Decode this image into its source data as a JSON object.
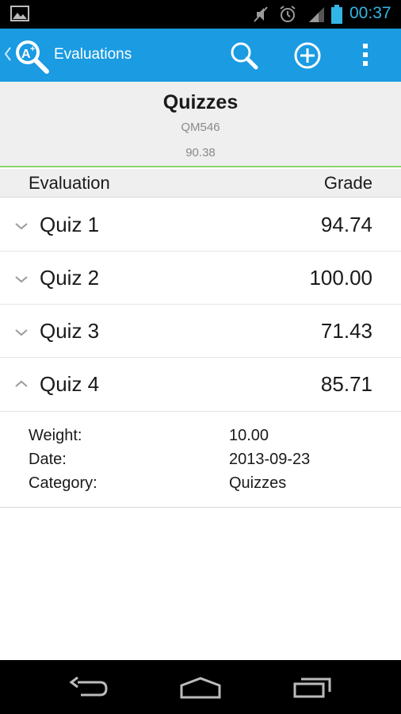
{
  "status_bar": {
    "time": "00:37",
    "icons": [
      "gallery-icon",
      "mute-icon",
      "alarm-icon",
      "signal-icon",
      "battery-icon"
    ],
    "accent": "#33b5e5"
  },
  "action_bar": {
    "title": "Evaluations",
    "color": "#1a9be2",
    "actions": [
      "search-icon",
      "add-icon",
      "overflow-menu-icon"
    ]
  },
  "course": {
    "name": "Quizzes",
    "code": "QM546",
    "average": "90.38"
  },
  "columns": {
    "evaluation": "Evaluation",
    "grade": "Grade"
  },
  "evaluations": [
    {
      "name": "Quiz 1",
      "grade": "94.74",
      "expanded": false
    },
    {
      "name": "Quiz 2",
      "grade": "100.00",
      "expanded": false
    },
    {
      "name": "Quiz 3",
      "grade": "71.43",
      "expanded": false
    },
    {
      "name": "Quiz 4",
      "grade": "85.71",
      "expanded": true
    }
  ],
  "details": {
    "weight_label": "Weight:",
    "weight_value": "10.00",
    "date_label": "Date:",
    "date_value": "2013-09-23",
    "category_label": "Category:",
    "category_value": "Quizzes"
  },
  "nav_bar": {
    "buttons": [
      "back-icon",
      "home-icon",
      "recent-apps-icon"
    ]
  }
}
